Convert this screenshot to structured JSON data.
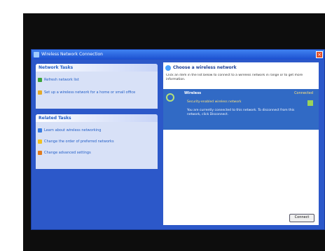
{
  "window": {
    "title": "Wireless Network Connection"
  },
  "task_pane": {
    "network_tasks": {
      "title": "Network Tasks",
      "items": [
        {
          "label": "Refresh network list",
          "icon": "refresh-icon"
        },
        {
          "label": "Set up a wireless network for a home or small office",
          "icon": "setup-icon"
        }
      ]
    },
    "related_tasks": {
      "title": "Related Tasks",
      "items": [
        {
          "label": "Learn about wireless networking",
          "icon": "info-icon"
        },
        {
          "label": "Change the order of preferred networks",
          "icon": "star-icon"
        },
        {
          "label": "Change advanced settings",
          "icon": "settings-icon"
        }
      ]
    }
  },
  "content": {
    "heading": "Choose a wireless network",
    "description": "Click an item in the list below to connect to a wireless network in range or to get more information.",
    "network": {
      "name": "Wireless",
      "status": "Connected",
      "security": "Security-enabled wireless network",
      "details": "You are currently connected to this network. To disconnect from this network, click Disconnect."
    },
    "connect_label": "Connect"
  },
  "colors": {
    "window_blue": "#2c58c9",
    "selection_blue": "#316ac5",
    "task_box": "#d8e1f7"
  }
}
